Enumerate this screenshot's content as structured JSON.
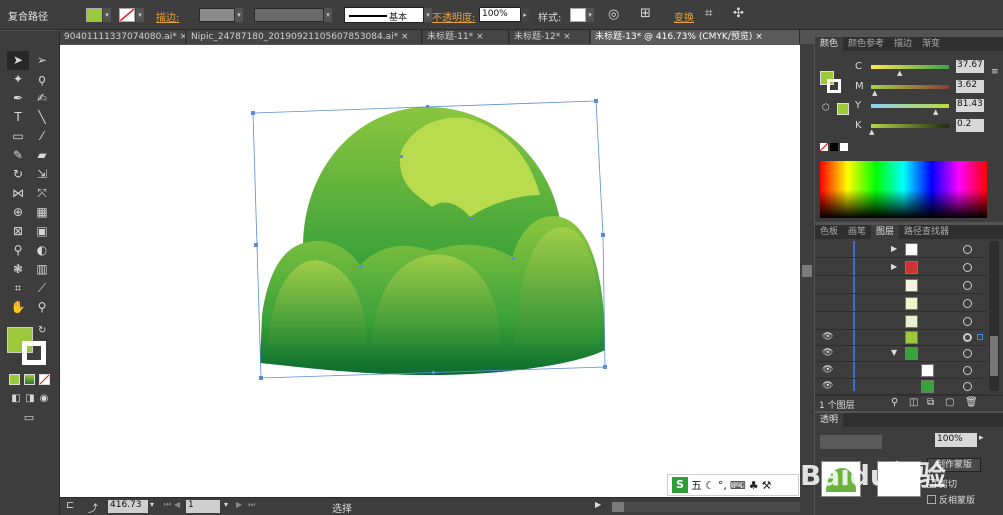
{
  "control_bar": {
    "selection_label": "复合路径",
    "stroke_label": "描边:",
    "stroke_profile": "基本",
    "opacity_label": "不透明度:",
    "opacity_value": "100%",
    "style_label": "样式:",
    "transform_label": "变换",
    "fill_color": "#9cc93b"
  },
  "doc_tabs": [
    {
      "label": "90401111337074080.ai*"
    },
    {
      "label": "Nipic_24787180_20190921105607853084.ai*"
    },
    {
      "label": "未标题-11*"
    },
    {
      "label": "未标题-12*"
    },
    {
      "label": "未标题-13* @ 416.73% (CMYK/预览)"
    }
  ],
  "color_panel": {
    "tabs": [
      "颜色",
      "颜色参考",
      "描边",
      "渐变"
    ],
    "channels": [
      {
        "name": "C",
        "value": "37.67"
      },
      {
        "name": "M",
        "value": "3.62"
      },
      {
        "name": "Y",
        "value": "81.43"
      },
      {
        "name": "K",
        "value": "0.2"
      }
    ]
  },
  "layers_panel": {
    "tabs": [
      "色板",
      "画笔",
      "图层",
      "路径查找器"
    ],
    "footer_label": "1 个图层"
  },
  "transparency_panel": {
    "title": "透明",
    "opacity": "100%",
    "make_mask": "制作蒙版",
    "clip": "剪切",
    "invert_mask": "反相蒙版"
  },
  "status_bar": {
    "zoom": "416.73",
    "artboard": "1",
    "tool_name": "选择"
  },
  "ime_bar": {
    "label": "五"
  },
  "watermark": {
    "text": "Baidu经验"
  },
  "colors": {
    "fill_green": "#9cc93b",
    "bush_light": "#8cc63f",
    "bush_dark": "#0b6b2e"
  }
}
